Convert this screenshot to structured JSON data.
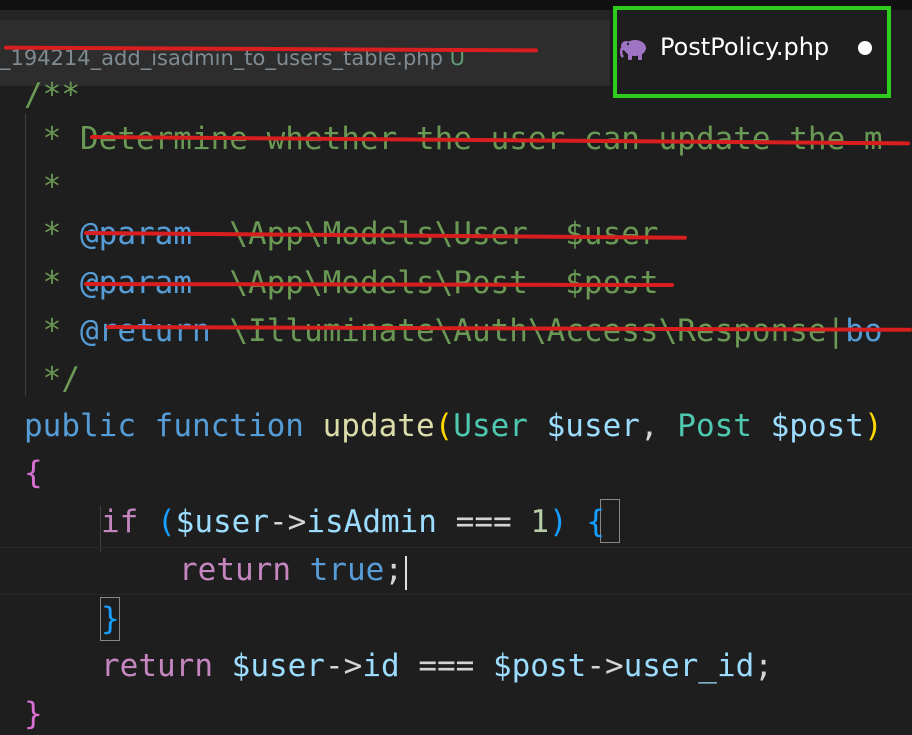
{
  "tabs": {
    "inactive": {
      "label": "_194214_add_isadmin_to_users_table.php",
      "status": "U"
    },
    "active": {
      "label": "PostPolicy.php",
      "icon": "php-elephant-icon",
      "dirty": true
    }
  },
  "code": {
    "doc_open": "/**",
    "doc_line_1": " * Determine whether the user can update the m",
    "doc_line_2": " *",
    "doc_param_1": {
      "star": " * ",
      "tag": "@param",
      "text": "  \\App\\Models\\User  $user"
    },
    "doc_param_2": {
      "star": " * ",
      "tag": "@param",
      "text": "  \\App\\Models\\Post  $post"
    },
    "doc_return": {
      "star": " * ",
      "tag": "@return",
      "text": " \\Illuminate\\Auth\\Access\\Response|",
      "tail": "bo"
    },
    "doc_close": " */",
    "signature": {
      "kw_public": "public",
      "kw_function": "function",
      "name": "update",
      "paren_open": "(",
      "type_1": "User",
      "var_1": "$user",
      "comma": ",",
      "type_2": "Post",
      "var_2": "$post",
      "paren_close": ")"
    },
    "brace_open": "{",
    "if_line": {
      "kw_if": "if",
      "paren_open": "(",
      "var": "$user",
      "arrow": "->",
      "prop": "isAdmin",
      "op": "===",
      "num": "1",
      "paren_close": ")",
      "brace": "{"
    },
    "return_true": {
      "kw": "return",
      "val": "true",
      "semi": ";"
    },
    "if_close": "}",
    "return_line": {
      "kw": "return",
      "var_1": "$user",
      "arrow_1": "->",
      "prop_1": "id",
      "op": "===",
      "var_2": "$post",
      "arrow_2": "->",
      "prop_2": "user_id",
      "semi": ";"
    },
    "brace_close": "}"
  },
  "colors": {
    "highlight_box": "#2ecc1c",
    "strike_marker": "#d81e1e"
  }
}
